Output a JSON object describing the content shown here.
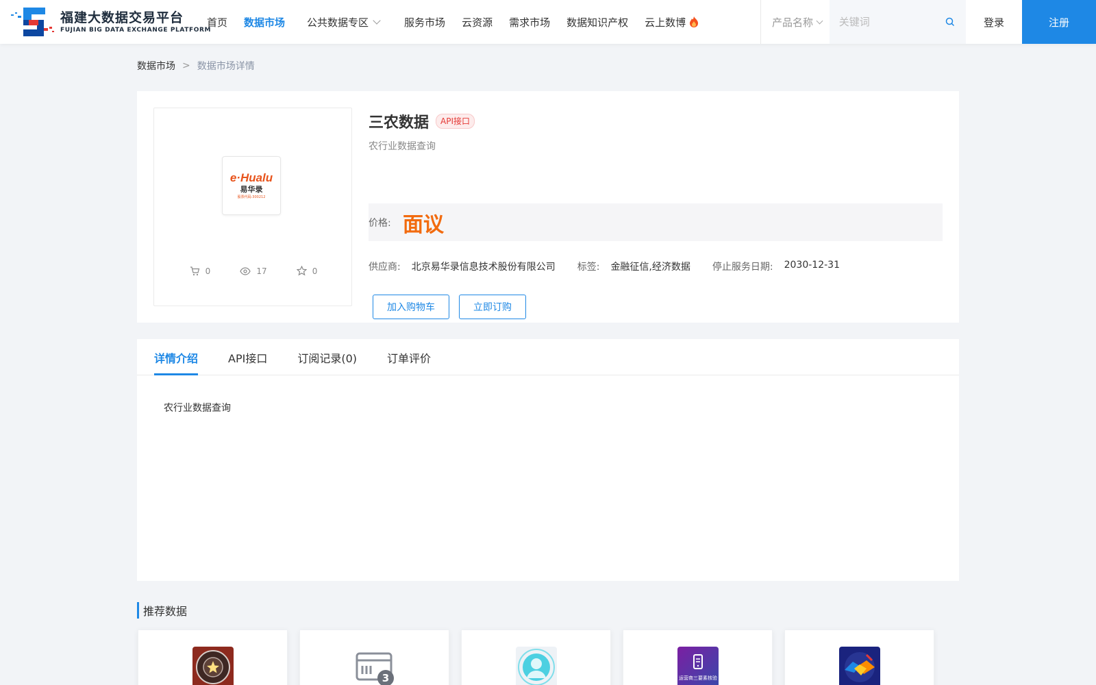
{
  "header": {
    "logo_cn": "福建大数据交易平台",
    "logo_en": "FUJIAN BIG DATA EXCHANGE  PLATFORM",
    "nav": [
      {
        "label": "首页",
        "active": false
      },
      {
        "label": "数据市场",
        "active": true
      },
      {
        "label": "公共数据专区",
        "active": false
      },
      {
        "label": "服务市场",
        "active": false
      },
      {
        "label": "云资源",
        "active": false
      },
      {
        "label": "需求市场",
        "active": false
      },
      {
        "label": "数据知识产权",
        "active": false
      },
      {
        "label": "云上数博",
        "active": false
      }
    ],
    "search": {
      "select_value": "产品名称",
      "placeholder": "关键词"
    },
    "login_label": "登录",
    "register_label": "注册",
    "accent_color": "#1e88e5"
  },
  "breadcrumb": {
    "parent": "数据市场",
    "separator": ">",
    "current": "数据市场详情"
  },
  "product": {
    "logo": {
      "brand_en": "e·Hualu",
      "brand_cn": "易华录",
      "code": "股票代码:300212"
    },
    "stats": {
      "cart_count": "0",
      "view_count": "17",
      "favorite_count": "0"
    },
    "title": "三农数据",
    "badge": "API接口",
    "subtitle": "农行业数据查询",
    "price_label": "价格:",
    "price_value": "面议",
    "price_color": "#f26b0f",
    "supplier_label": "供应商:",
    "supplier_value": "北京易华录信息技术股份有限公司",
    "tags_label": "标签:",
    "tags_value": "金融征信,经济数据",
    "end_date_label": "停止服务日期:",
    "end_date_value": "2030-12-31",
    "add_cart_label": "加入购物车",
    "subscribe_label": "立即订购"
  },
  "tabs": [
    {
      "label": "详情介绍",
      "active": true
    },
    {
      "label": "API接口",
      "active": false
    },
    {
      "label": "订阅记录(0)",
      "active": false
    },
    {
      "label": "订单评价",
      "active": false
    }
  ],
  "detail_text": "农行业数据查询",
  "recommended": {
    "title": "推荐数据",
    "items": [
      {
        "icon": "shield-emblem-icon"
      },
      {
        "icon": "id-card-icon"
      },
      {
        "icon": "face-recognition-icon"
      },
      {
        "icon": "mobile-verify-icon",
        "caption": "运营商三要素核验"
      },
      {
        "icon": "handshake-icon"
      }
    ]
  }
}
